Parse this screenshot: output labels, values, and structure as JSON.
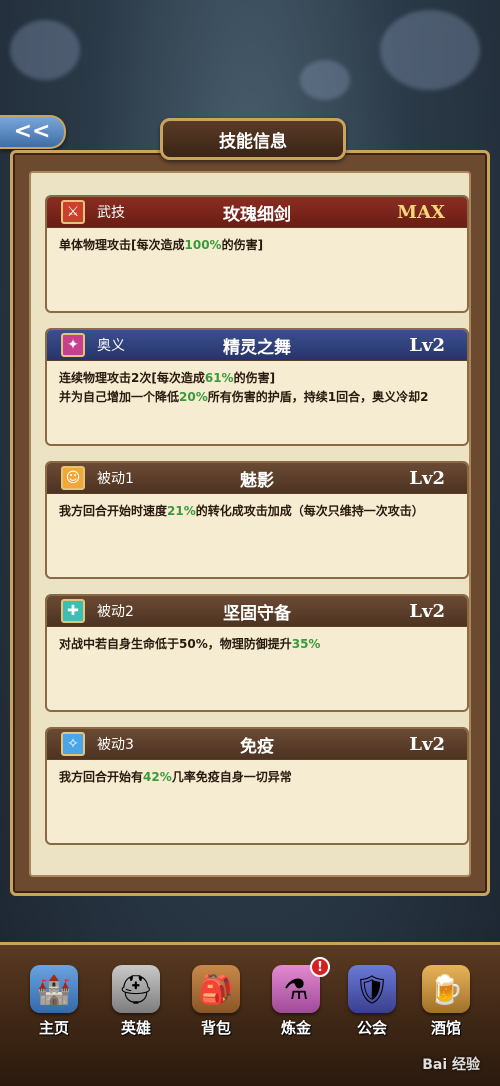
{
  "title": "技能信息",
  "back_button": "<<",
  "skills": [
    {
      "type": "武技",
      "name": "玫瑰细剑",
      "level": "MAX",
      "icon": "sword-icon",
      "desc": [
        {
          "t": "单体物理攻击[每次造成"
        },
        {
          "t": "100%",
          "hl": true
        },
        {
          "t": "的伤害]"
        }
      ]
    },
    {
      "type": "奥义",
      "name": "精灵之舞",
      "level": "Lv2",
      "icon": "dance-icon",
      "desc": [
        {
          "t": "连续物理攻击2次[每次造成"
        },
        {
          "t": "61%",
          "hl": true
        },
        {
          "t": "的伤害]\n并为自己增加一个降低"
        },
        {
          "t": "20%",
          "hl": true
        },
        {
          "t": "所有伤害的护盾，持续1回合，奥义冷却2"
        }
      ]
    },
    {
      "type": "被动1",
      "name": "魅影",
      "level": "Lv2",
      "icon": "phantom-icon",
      "desc": [
        {
          "t": "我方回合开始时速度"
        },
        {
          "t": "21%",
          "hl": true
        },
        {
          "t": "的转化成攻击加成（每次只维持一次攻击）"
        }
      ]
    },
    {
      "type": "被动2",
      "name": "坚固守备",
      "level": "Lv2",
      "icon": "defense-icon",
      "desc": [
        {
          "t": "对战中若自身生命低于50%，物理防御提升"
        },
        {
          "t": "35%",
          "hl": true
        }
      ]
    },
    {
      "type": "被动3",
      "name": "免疫",
      "level": "Lv2",
      "icon": "immunity-icon",
      "desc": [
        {
          "t": "我方回合开始有"
        },
        {
          "t": "42%",
          "hl": true
        },
        {
          "t": "几率免疫自身一切异常"
        }
      ]
    }
  ],
  "nav": [
    {
      "label": "主页",
      "icon": "castle-icon"
    },
    {
      "label": "英雄",
      "icon": "helmet-icon"
    },
    {
      "label": "背包",
      "icon": "bag-icon"
    },
    {
      "label": "炼金",
      "icon": "potion-icon",
      "badge": "!"
    },
    {
      "label": "公会",
      "icon": "guild-shield-icon"
    },
    {
      "label": "酒馆",
      "icon": "tavern-icon"
    }
  ],
  "watermark": "Bai 经验",
  "colors": {
    "highlight": "#3a9a3a",
    "gold": "#c9a45c",
    "max": "#f5d77a"
  }
}
